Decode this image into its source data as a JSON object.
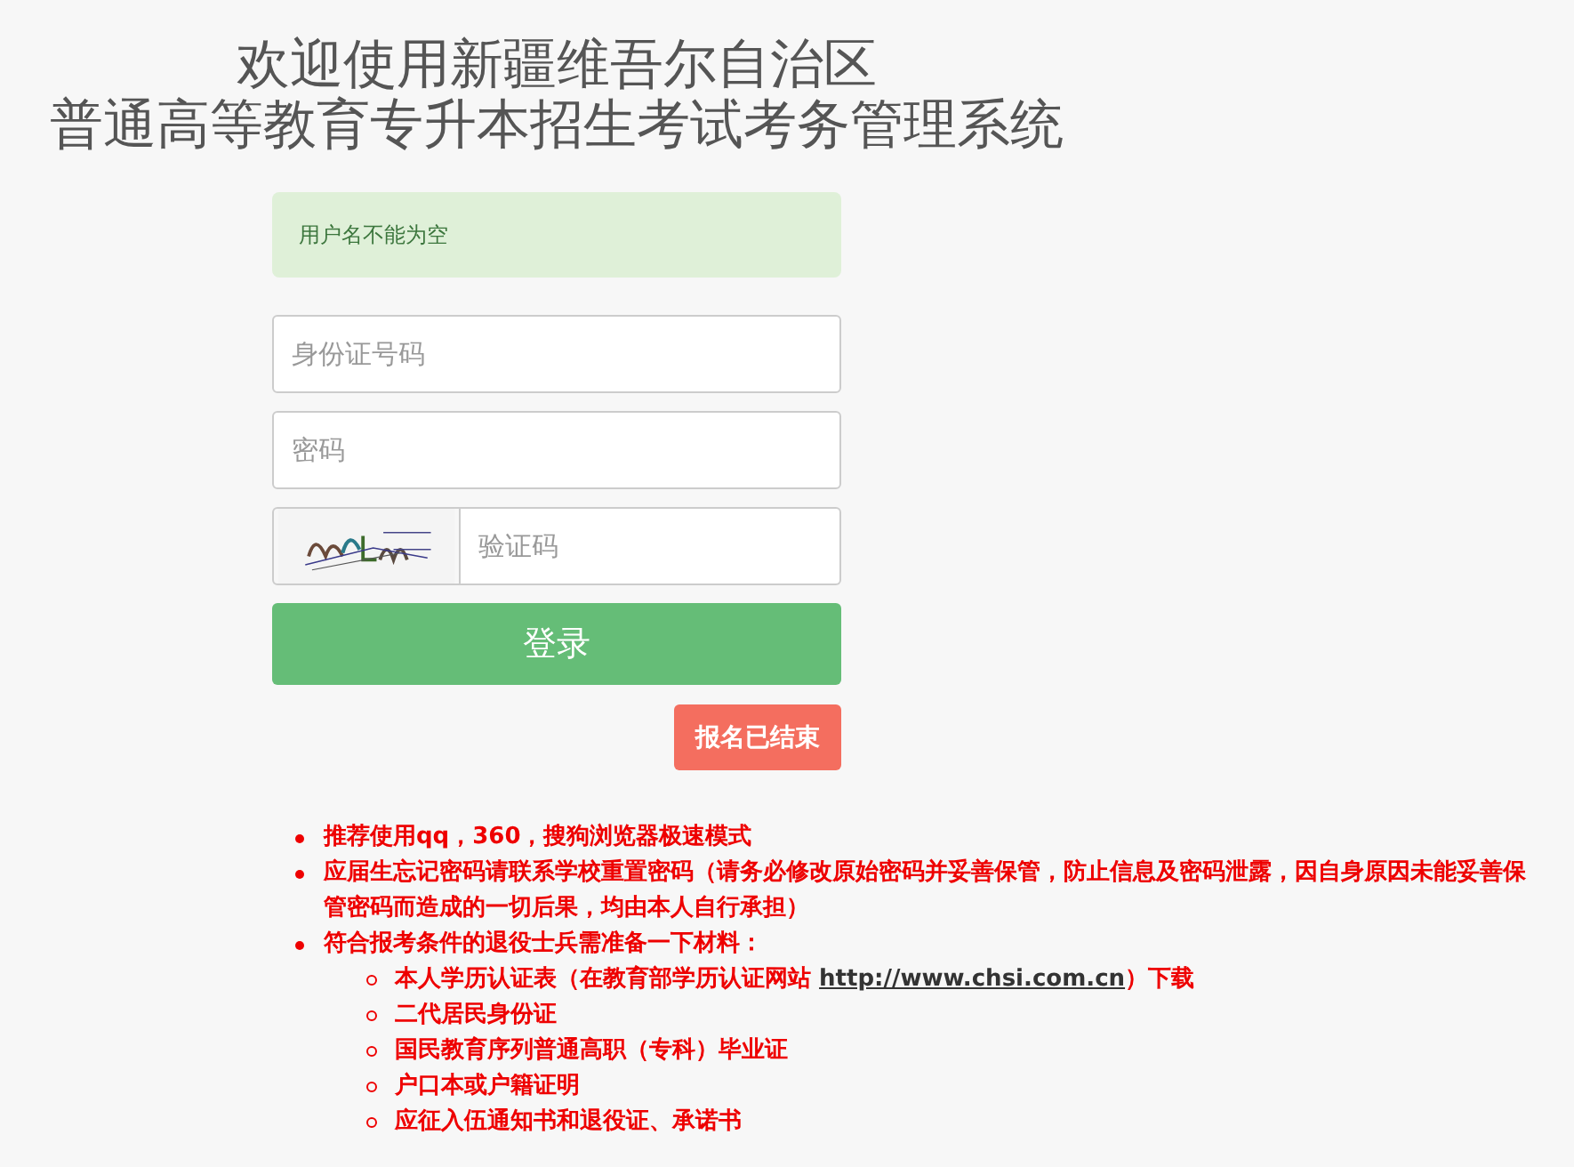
{
  "title_lines": [
    "欢迎使用新疆维吾尔自治区",
    "普通高等教育专升本招生考试考务管理系统"
  ],
  "alert": {
    "text": "用户名不能为空"
  },
  "fields": [
    {
      "kind": "text",
      "placeholder": "身份证号码"
    },
    {
      "kind": "password",
      "placeholder": "密码"
    },
    {
      "kind": "captcha",
      "placeholder": "验证码"
    }
  ],
  "login_button": "登录",
  "status_button": "报名已结束",
  "notes": [
    {
      "text": "推荐使用qq，360，搜狗浏览器极速模式"
    },
    {
      "text": "应届生忘记密码请联系学校重置密码（请务必修改原始密码并妥善保管，防止信息及密码泄露，因自身原因未能妥善保管密码而造成的一切后果，均由本人自行承担）"
    },
    {
      "text": "符合报考条件的退役士兵需准备一下材料：",
      "children": [
        {
          "text": "本人学历认证表（在教育部学历认证网站 ",
          "link": "http://www.chsi.com.cn",
          "after": "）下载"
        },
        {
          "text": "二代居民身份证"
        },
        {
          "text": "国民教育序列普通高职（专科）毕业证"
        },
        {
          "text": "户口本或户籍证明"
        },
        {
          "text": "应征入伍通知书和退役证、承诺书"
        }
      ]
    }
  ]
}
